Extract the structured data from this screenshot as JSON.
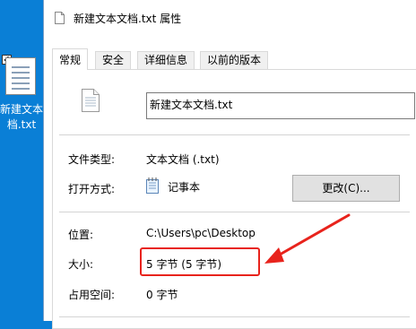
{
  "desktop": {
    "icon_label_line1": "新建文本文",
    "icon_label_line2": "档.txt",
    "checkbox_mark": "✓"
  },
  "window": {
    "title": "新建文本文档.txt 属性"
  },
  "tabs": [
    {
      "label": "常规",
      "active": true
    },
    {
      "label": "安全",
      "active": false
    },
    {
      "label": "详细信息",
      "active": false
    },
    {
      "label": "以前的版本",
      "active": false
    }
  ],
  "general": {
    "file_name": "新建文本文档.txt",
    "file_type_label": "文件类型:",
    "file_type_value": "文本文档 (.txt)",
    "opens_with_label": "打开方式:",
    "opens_with_value": "记事本",
    "change_button": "更改(C)...",
    "location_label": "位置:",
    "location_value": "C:\\Users\\pc\\Desktop",
    "size_label": "大小:",
    "size_value": "5 字节 (5 字节)",
    "size_on_disk_label": "占用空间:",
    "size_on_disk_value": "0 字节"
  },
  "colors": {
    "desktop_bg": "#0a7fd6",
    "highlight": "#e8231c"
  }
}
